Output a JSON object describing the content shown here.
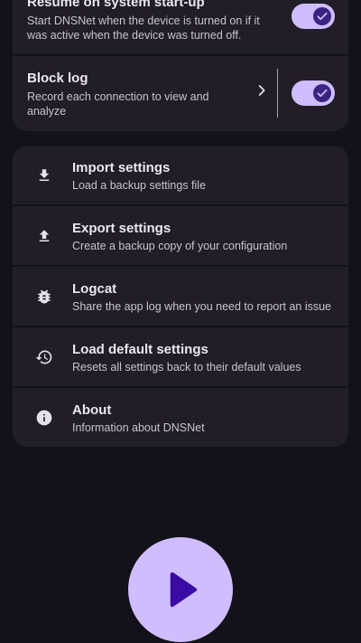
{
  "settings": {
    "resume": {
      "title": "Resume on system start-up",
      "subtitle": "Start DNSNet when the device is turned on if it was active when the device was turned off.",
      "enabled": true
    },
    "block_log": {
      "title": "Block log",
      "subtitle": "Record each connection to view and analyze",
      "enabled": true
    }
  },
  "actions": [
    {
      "icon": "download-icon",
      "title": "Import settings",
      "subtitle": "Load a backup settings file"
    },
    {
      "icon": "upload-icon",
      "title": "Export settings",
      "subtitle": "Create a backup copy of your configuration"
    },
    {
      "icon": "bug-icon",
      "title": "Logcat",
      "subtitle": "Share the app log when you need to report an issue"
    },
    {
      "icon": "restore-icon",
      "title": "Load default settings",
      "subtitle": "Resets all settings back to their default values"
    },
    {
      "icon": "info-icon",
      "title": "About",
      "subtitle": "Information about DNSNet"
    }
  ],
  "fab": {
    "icon": "play-icon"
  },
  "colors": {
    "background": "#13111a",
    "card": "#211e27",
    "accent": "#cfbdfe",
    "accent_dark": "#3b2481",
    "fab_icon": "#3a0ca3"
  }
}
